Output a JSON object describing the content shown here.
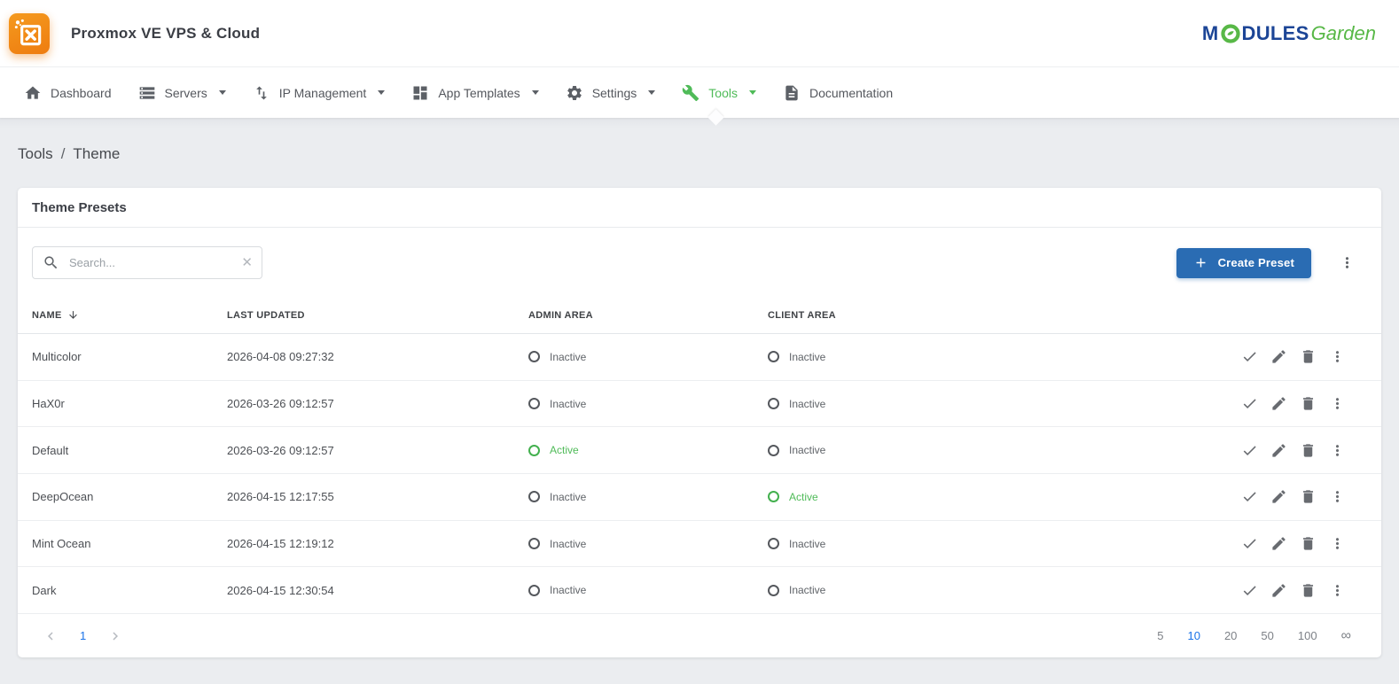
{
  "app": {
    "title": "Proxmox VE VPS & Cloud",
    "brand": {
      "modules_prefix": "M",
      "modules_rest": "DULES",
      "garden": "Garden"
    }
  },
  "nav": {
    "items": [
      {
        "label": "Dashboard",
        "icon": "home",
        "caret": false,
        "active": false
      },
      {
        "label": "Servers",
        "icon": "servers",
        "caret": true,
        "active": false
      },
      {
        "label": "IP Management",
        "icon": "import-export",
        "caret": true,
        "active": false
      },
      {
        "label": "App Templates",
        "icon": "app-grid",
        "caret": true,
        "active": false
      },
      {
        "label": "Settings",
        "icon": "gear",
        "caret": true,
        "active": false
      },
      {
        "label": "Tools",
        "icon": "wrench",
        "caret": true,
        "active": true
      },
      {
        "label": "Documentation",
        "icon": "document",
        "caret": false,
        "active": false
      }
    ]
  },
  "breadcrumb": {
    "items": [
      "Tools",
      "Theme"
    ],
    "separator": "/"
  },
  "panel": {
    "title": "Theme Presets"
  },
  "toolbar": {
    "search_placeholder": "Search...",
    "search_value": "",
    "create_button_label": "Create Preset"
  },
  "table": {
    "columns": {
      "name": "NAME",
      "last_updated": "LAST UPDATED",
      "admin_area": "ADMIN AREA",
      "client_area": "CLIENT AREA"
    },
    "sort": {
      "column": "NAME",
      "direction": "desc"
    },
    "rows": [
      {
        "name": "Multicolor",
        "last_updated": "2026-04-08 09:27:32",
        "admin": {
          "label": "Inactive",
          "state": "inactive"
        },
        "client": {
          "label": "Inactive",
          "state": "inactive"
        }
      },
      {
        "name": "HaX0r",
        "last_updated": "2026-03-26 09:12:57",
        "admin": {
          "label": "Inactive",
          "state": "inactive"
        },
        "client": {
          "label": "Inactive",
          "state": "inactive"
        }
      },
      {
        "name": "Default",
        "last_updated": "2026-03-26 09:12:57",
        "admin": {
          "label": "Active",
          "state": "active"
        },
        "client": {
          "label": "Inactive",
          "state": "inactive"
        }
      },
      {
        "name": "DeepOcean",
        "last_updated": "2026-04-15 12:17:55",
        "admin": {
          "label": "Inactive",
          "state": "inactive"
        },
        "client": {
          "label": "Active",
          "state": "active"
        }
      },
      {
        "name": "Mint Ocean",
        "last_updated": "2026-04-15 12:19:12",
        "admin": {
          "label": "Inactive",
          "state": "inactive"
        },
        "client": {
          "label": "Inactive",
          "state": "inactive"
        }
      },
      {
        "name": "Dark",
        "last_updated": "2026-04-15 12:30:54",
        "admin": {
          "label": "Inactive",
          "state": "inactive"
        },
        "client": {
          "label": "Inactive",
          "state": "inactive"
        }
      }
    ]
  },
  "pagination": {
    "current_page": "1",
    "page_sizes": [
      "5",
      "10",
      "20",
      "50",
      "100",
      "∞"
    ],
    "active_page_size": "10"
  },
  "colors": {
    "brand_orange": "#f08018",
    "accent_green": "#4fbb58",
    "button_blue": "#2a6cb3",
    "link_blue": "#1a73e8",
    "brand_navy": "#1c4596",
    "brand_green": "#58b847"
  }
}
